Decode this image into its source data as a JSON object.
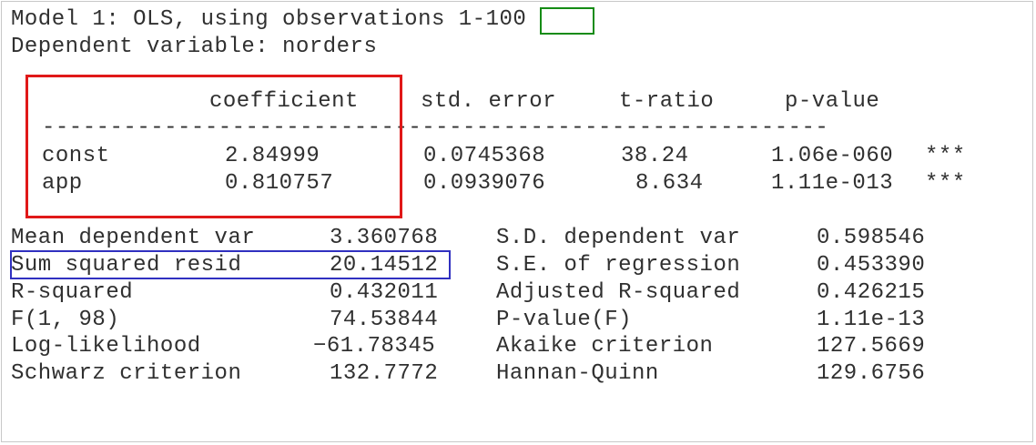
{
  "header": {
    "model_prefix": "Model 1: OLS, using observations 1-",
    "observations_end": "100",
    "dependent_line": "Dependent variable: norders"
  },
  "table": {
    "columns": [
      "coefficient",
      "std. error",
      "t-ratio",
      "p-value"
    ],
    "separator": "----------------------------------------------------------",
    "rows": [
      {
        "name": "const",
        "coefficient": "2.84999",
        "std_error": "0.0745368",
        "t_ratio": "38.24",
        "p_value": "1.06e-060",
        "stars": "***"
      },
      {
        "name": "app",
        "coefficient": "0.810757",
        "std_error": "0.0939076",
        "t_ratio": "8.634",
        "p_value": "1.11e-013",
        "stars": "***"
      }
    ]
  },
  "stats": [
    {
      "label": "Mean dependent var",
      "value": "3.360768",
      "label2": "S.D. dependent var",
      "value2": "0.598546"
    },
    {
      "label": "Sum squared resid",
      "value": "20.14512",
      "label2": "S.E. of regression",
      "value2": "0.453390"
    },
    {
      "label": "R-squared",
      "value": "0.432011",
      "label2": "Adjusted R-squared",
      "value2": "0.426215"
    },
    {
      "label": "F(1, 98)",
      "value": "74.53844",
      "label2": "P-value(F)",
      "value2": "1.11e-13"
    },
    {
      "label": "Log-likelihood",
      "value": "−61.78345",
      "label2": "Akaike criterion",
      "value2": "127.5669"
    },
    {
      "label": "Schwarz criterion",
      "value": "132.7772",
      "label2": "Hannan-Quinn",
      "value2": "129.6756"
    }
  ],
  "colors": {
    "observations_highlight": "#158c15",
    "coefficient_highlight": "#e01818",
    "ssr_highlight": "#3030c0"
  }
}
